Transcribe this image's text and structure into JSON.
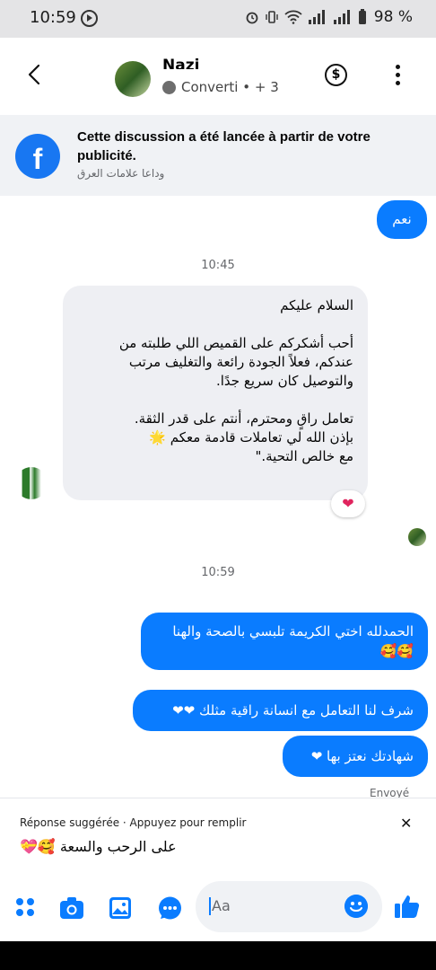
{
  "status_bar": {
    "time": "10:59",
    "battery": "98 %"
  },
  "header": {
    "name": "Nazi",
    "subtitle": "Converti • + 3"
  },
  "ad_banner": {
    "title": "Cette discussion a été lancée à partir de votre publicité.",
    "subtitle": "وداعا علامات العرق"
  },
  "messages": {
    "first_out": "نعم",
    "time_1": "10:45",
    "incoming": [
      "السلام عليكم",
      "",
      "أحب أشكركم على القميص اللي طلبته من عندكم، فعلاً الجودة رائعة والتغليف مرتب والتوصيل كان سريع جدًا.",
      "",
      "تعامل راقٍ ومحترم، أنتم على قدر الثقة.",
      "بإذن الله لي تعاملات قادمة معكم 🌟",
      "مع خالص التحية.\""
    ],
    "reaction": "❤",
    "time_2": "10:59",
    "out_1": "الحمدلله اختي الكريمة  تلبسي بالصحة والهنا 🥰🥰",
    "out_2": "شرف لنا التعامل مع انسانة راقية مثلك ❤❤",
    "out_3": "شهادتك نعتز بها ❤",
    "sent_status": "Envoyé"
  },
  "suggestion": {
    "label": "Réponse suggérée · Appuyez pour remplir",
    "text": "على الرحب والسعة 🥰💝"
  },
  "composer": {
    "placeholder": "Aa"
  },
  "colors": {
    "accent": "#0a7cff",
    "incoming_bubble": "#eeeff3",
    "banner_bg": "#f0f2f5"
  }
}
